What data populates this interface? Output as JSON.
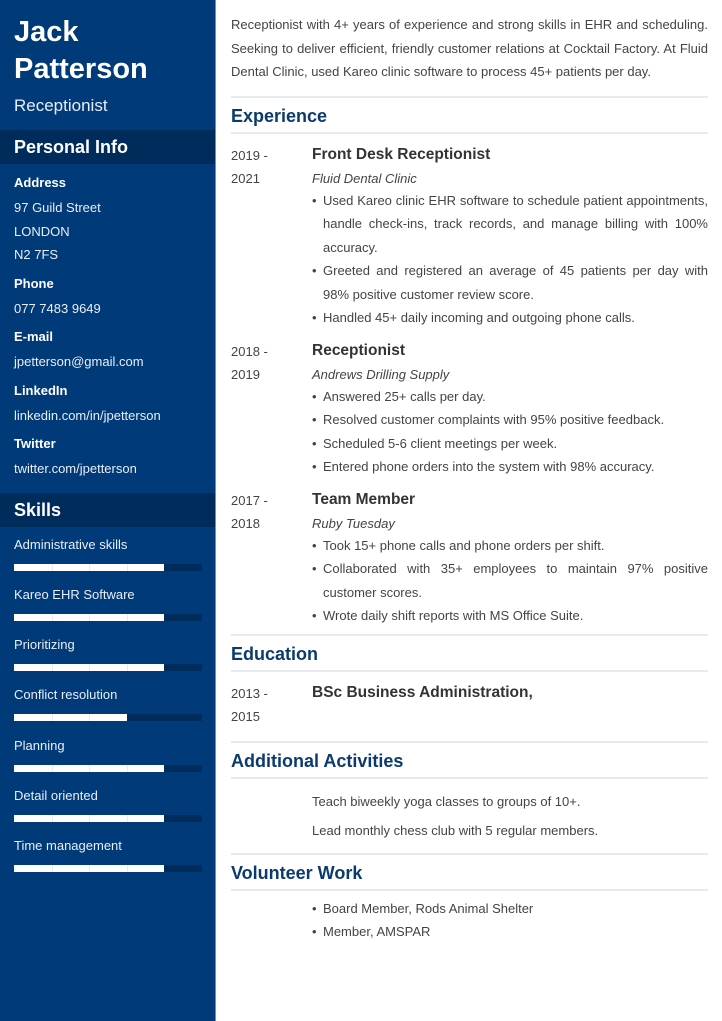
{
  "sidebar": {
    "name_first": "Jack",
    "name_last": "Patterson",
    "role": "Receptionist",
    "personal_info_heading": "Personal Info",
    "address": {
      "label": "Address",
      "lines": [
        "97 Guild Street",
        "LONDON",
        "N2 7FS"
      ]
    },
    "phone": {
      "label": "Phone",
      "value": "077 7483 9649"
    },
    "email": {
      "label": "E-mail",
      "value": "jpetterson@gmail.com"
    },
    "linkedin": {
      "label": "LinkedIn",
      "value": "linkedin.com/in/jpetterson"
    },
    "twitter": {
      "label": "Twitter",
      "value": "twitter.com/jpetterson"
    },
    "skills_heading": "Skills",
    "skills": [
      {
        "name": "Administrative skills",
        "level": 4,
        "max": 5
      },
      {
        "name": "Kareo EHR Software",
        "level": 4,
        "max": 5
      },
      {
        "name": "Prioritizing",
        "level": 4,
        "max": 5
      },
      {
        "name": "Conflict resolution",
        "level": 3,
        "max": 5
      },
      {
        "name": "Planning",
        "level": 4,
        "max": 5
      },
      {
        "name": "Detail oriented",
        "level": 4,
        "max": 5
      },
      {
        "name": "Time management",
        "level": 4,
        "max": 5
      }
    ]
  },
  "main": {
    "summary": "Receptionist with 4+ years of experience and strong skills in EHR and scheduling. Seeking to deliver efficient, friendly customer relations at Cocktail Factory. At Fluid Dental Clinic, used Kareo clinic software to process 45+ patients per day.",
    "experience_heading": "Experience",
    "experience": [
      {
        "date_start": "2019 -",
        "date_end": "2021",
        "title": "Front Desk Receptionist",
        "company": "Fluid Dental Clinic",
        "bullets": [
          "Used Kareo clinic EHR software to schedule patient appointments, handle check-ins, track records, and manage billing with 100% accuracy.",
          "Greeted and registered an average of 45 patients per day with 98% positive customer review score.",
          "Handled 45+ daily incoming and outgoing phone calls."
        ]
      },
      {
        "date_start": "2018 -",
        "date_end": "2019",
        "title": "Receptionist",
        "company": "Andrews Drilling Supply",
        "bullets": [
          "Answered 25+ calls per day.",
          "Resolved customer complaints with 95% positive feedback.",
          "Scheduled 5-6 client meetings per week.",
          "Entered phone orders into the system with 98% accuracy."
        ]
      },
      {
        "date_start": "2017 -",
        "date_end": "2018",
        "title": "Team Member",
        "company": "Ruby Tuesday",
        "bullets": [
          "Took 15+ phone calls and phone orders per shift.",
          "Collaborated with 35+ employees to maintain 97% positive customer scores.",
          "Wrote daily shift reports with MS Office Suite."
        ]
      }
    ],
    "education_heading": "Education",
    "education": [
      {
        "date_start": "2013 -",
        "date_end": "2015",
        "degree": "BSc Business Administration,"
      }
    ],
    "activities_heading": "Additional Activities",
    "activities": [
      "Teach biweekly yoga classes to groups of 10+.",
      "Lead monthly chess club with 5 regular members."
    ],
    "volunteer_heading": "Volunteer Work",
    "volunteer": [
      "Board Member, Rods Animal Shelter",
      "Member, AMSPAR"
    ]
  }
}
